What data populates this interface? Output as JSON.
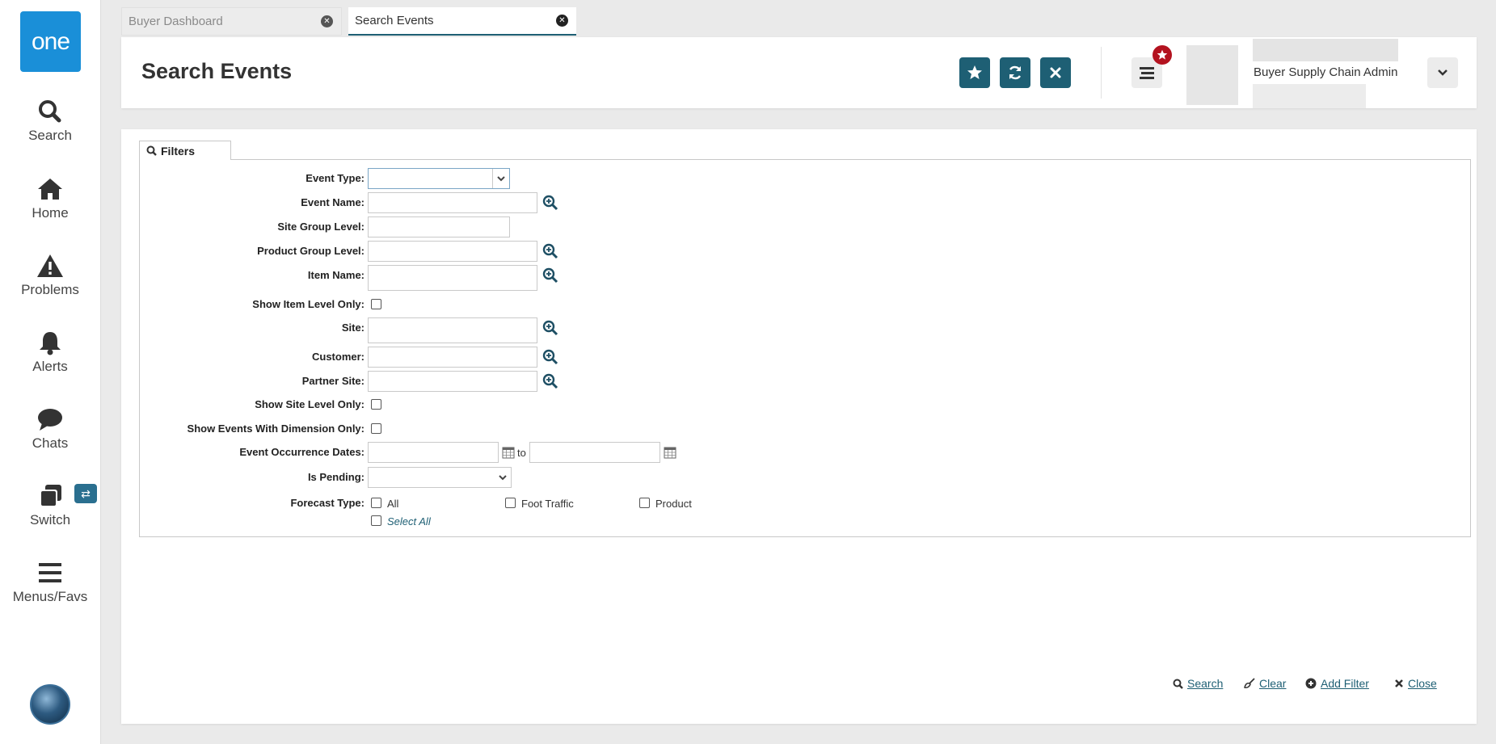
{
  "sidebar": {
    "logo_text": "one",
    "items": [
      {
        "label": "Search",
        "icon": "search-icon"
      },
      {
        "label": "Home",
        "icon": "home-icon"
      },
      {
        "label": "Problems",
        "icon": "warning-icon"
      },
      {
        "label": "Alerts",
        "icon": "bell-icon"
      },
      {
        "label": "Chats",
        "icon": "chat-icon"
      },
      {
        "label": "Switch",
        "icon": "switch-icon"
      },
      {
        "label": "Menus/Favs",
        "icon": "menu-icon"
      }
    ]
  },
  "tabs": [
    {
      "label": "Buyer Dashboard",
      "active": false
    },
    {
      "label": "Search Events",
      "active": true
    }
  ],
  "header": {
    "title": "Search Events",
    "user_role": "Buyer Supply Chain Admin",
    "accent_color": "#1e5f74"
  },
  "filters": {
    "tab_label": "Filters",
    "fields": {
      "event_type": "Event Type:",
      "event_name": "Event Name:",
      "site_group_level": "Site Group Level:",
      "product_group_level": "Product Group Level:",
      "item_name": "Item Name:",
      "show_item_level_only": "Show Item Level Only:",
      "site": "Site:",
      "customer": "Customer:",
      "partner_site": "Partner Site:",
      "show_site_level_only": "Show Site Level Only:",
      "show_events_with_dimension_only": "Show Events With Dimension Only:",
      "event_occurrence_dates": "Event Occurrence Dates:",
      "to": "to",
      "is_pending": "Is Pending:",
      "forecast_type": "Forecast Type:"
    },
    "forecast_options": [
      "All",
      "Foot Traffic",
      "Product"
    ],
    "select_all": "Select All"
  },
  "actions": {
    "search": "Search",
    "clear": "Clear",
    "add_filter": "Add Filter",
    "close": "Close"
  }
}
